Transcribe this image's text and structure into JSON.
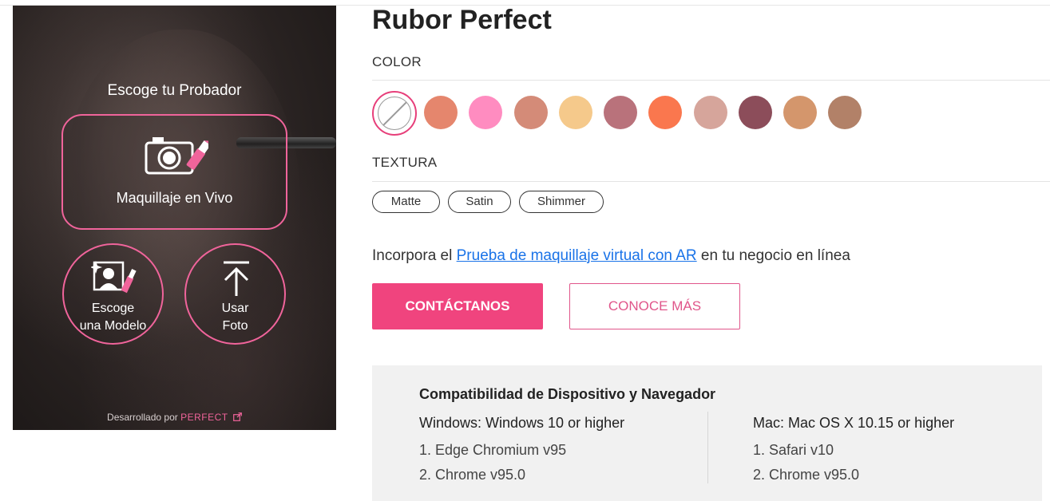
{
  "tryon": {
    "title": "Escoge tu Probador",
    "live_label": "Maquillaje en Vivo",
    "model_label_line1": "Escoge",
    "model_label_line2": "una Modelo",
    "photo_label_line1": "Usar",
    "photo_label_line2": "Foto",
    "powered_by": "Desarrollado por",
    "powered_brand": "PERFECT",
    "accent_color": "#f0649b",
    "icons": [
      "camera-lipstick-icon",
      "model-portrait-icon",
      "upload-arrow-icon",
      "external-link-icon"
    ]
  },
  "product": {
    "title": "Rubor Perfect",
    "color_label": "COLOR",
    "texture_label": "TEXTURA",
    "swatches": [
      "#e5866d",
      "#ff8cc0",
      "#d48b78",
      "#f5c98b",
      "#b9727b",
      "#fa774e",
      "#d6a59b",
      "#8c4d5a",
      "#d4966c",
      "#b28168"
    ],
    "textures": [
      "Matte",
      "Satin",
      "Shimmer"
    ]
  },
  "promo": {
    "prefix": "Incorpora el ",
    "link": "Prueba de maquillaje virtual con AR",
    "suffix": " en tu negocio en línea"
  },
  "buttons": {
    "contact": "CONTÁCTANOS",
    "more": "CONOCE MÁS",
    "primary_color": "#f0447e"
  },
  "compat": {
    "title": "Compatibilidad de Dispositivo y Navegador",
    "windows": {
      "head": "Windows: Windows 10 or higher",
      "items": [
        "1. Edge Chromium v95",
        "2. Chrome v95.0"
      ]
    },
    "mac": {
      "head": "Mac: Mac OS X 10.15 or higher",
      "items": [
        "1. Safari v10",
        "2. Chrome v95.0"
      ]
    }
  }
}
